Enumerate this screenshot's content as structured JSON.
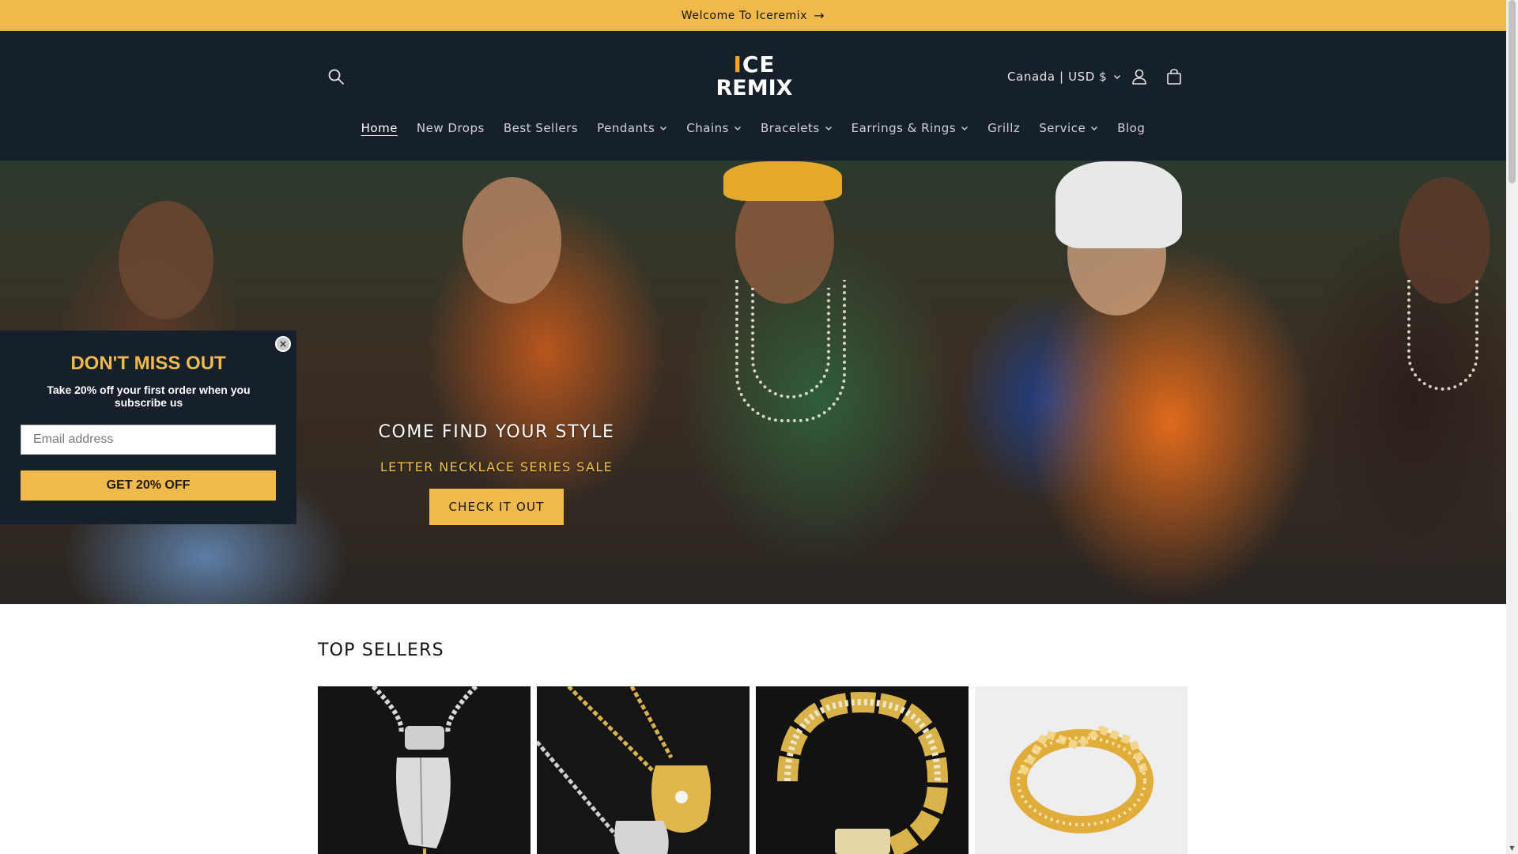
{
  "announcement": {
    "text": "Welcome To Iceremix",
    "arrow": "→"
  },
  "header": {
    "logo_line1_accent": "I",
    "logo_line1_rest": "CE",
    "logo_line2": "REMIX",
    "currency": "Canada | USD $",
    "icons": {
      "search": "search-icon",
      "account": "account-icon",
      "cart": "cart-icon"
    }
  },
  "nav": {
    "items": [
      {
        "label": "Home",
        "dropdown": false,
        "active": true
      },
      {
        "label": "New Drops",
        "dropdown": false
      },
      {
        "label": "Best Sellers",
        "dropdown": false
      },
      {
        "label": "Pendants",
        "dropdown": true
      },
      {
        "label": "Chains",
        "dropdown": true
      },
      {
        "label": "Bracelets",
        "dropdown": true
      },
      {
        "label": "Earrings & Rings",
        "dropdown": true
      },
      {
        "label": "Grillz",
        "dropdown": false
      },
      {
        "label": "Service",
        "dropdown": true
      },
      {
        "label": "Blog",
        "dropdown": false
      }
    ]
  },
  "hero": {
    "title": "COME FIND YOUR STYLE",
    "subtitle": "LETTER NECKLACE SERIES SALE",
    "button": "CHECK IT OUT"
  },
  "popup": {
    "title": "DON'T MISS OUT",
    "text": "Take 20% off your first order when you subscribe us",
    "email_placeholder": "Email address",
    "button": "GET 20% OFF",
    "close": "×"
  },
  "top_sellers": {
    "title": "TOP SELLERS",
    "products": [
      {
        "name": "praying-hands-pendant",
        "background": "#141414"
      },
      {
        "name": "hamsa-hand-pendants",
        "background": "#151515"
      },
      {
        "name": "cuban-link-bracelet",
        "background": "#121212"
      },
      {
        "name": "cuban-link-ring",
        "background": "#eeeeee"
      }
    ]
  },
  "colors": {
    "accent": "#f0b94b",
    "header_bg": "#15202b",
    "popup_title": "#f0b94b"
  }
}
